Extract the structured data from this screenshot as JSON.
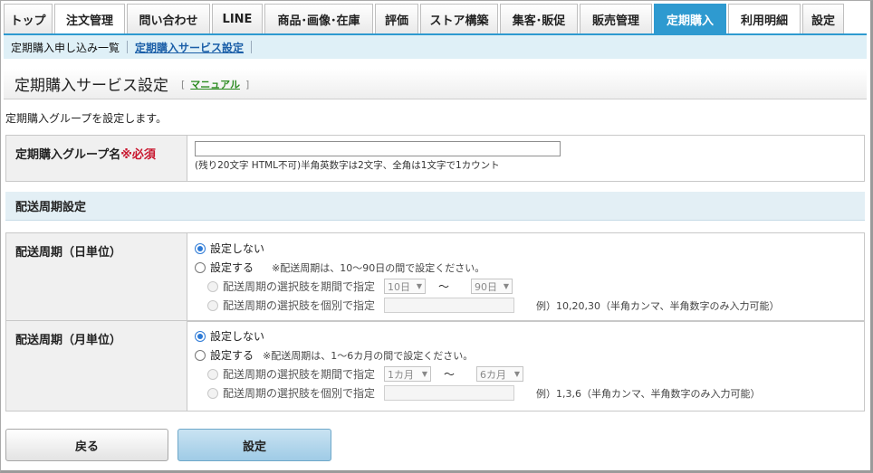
{
  "nav": {
    "tabs": [
      {
        "label": "トップ",
        "width": 54
      },
      {
        "label": "注文管理",
        "width": 78
      },
      {
        "label": "問い合わせ",
        "width": 92
      },
      {
        "label": "LINE",
        "width": 56
      },
      {
        "label": "商品･画像･在庫",
        "width": 120
      },
      {
        "label": "評価",
        "width": 48
      },
      {
        "label": "ストア構築",
        "width": 86
      },
      {
        "label": "集客･販促",
        "width": 86
      },
      {
        "label": "販売管理",
        "width": 80
      },
      {
        "label": "定期購入",
        "width": 80
      },
      {
        "label": "利用明細",
        "width": 80
      },
      {
        "label": "設定",
        "width": 46
      }
    ],
    "active_index": 9
  },
  "subnav": {
    "items": [
      "定期購入申し込み一覧",
      "定期購入サービス設定"
    ]
  },
  "page": {
    "title": "定期購入サービス設定",
    "manual_link": "マニュアル",
    "description": "定期購入グループを設定します。"
  },
  "group": {
    "label": "定期購入グループ名",
    "required": "※必須",
    "value": "",
    "note": "(残り20文字 HTML不可)半角英数字は2文字、全角は1文字で1カウント"
  },
  "section_title": "配送周期設定",
  "daily": {
    "label": "配送周期（日単位）",
    "opt_none": "設定しない",
    "opt_set": "設定する",
    "hint": "※配送周期は、10〜90日の間で設定ください。",
    "sub_range": "配送周期の選択肢を期間で指定",
    "from": "10日",
    "tilde": "〜",
    "to": "90日",
    "sub_individual": "配送周期の選択肢を個別で指定",
    "example": "例）10,20,30（半角カンマ、半角数字のみ入力可能）"
  },
  "monthly": {
    "label": "配送周期（月単位）",
    "opt_none": "設定しない",
    "opt_set": "設定する",
    "hint": "※配送周期は、1〜6カ月の間で設定ください。",
    "sub_range": "配送周期の選択肢を期間で指定",
    "from": "1カ月",
    "tilde": "〜",
    "to": "6カ月",
    "sub_individual": "配送周期の選択肢を個別で指定",
    "example": "例）1,3,6（半角カンマ、半角数字のみ入力可能）"
  },
  "buttons": {
    "back": "戻る",
    "submit": "設定"
  }
}
